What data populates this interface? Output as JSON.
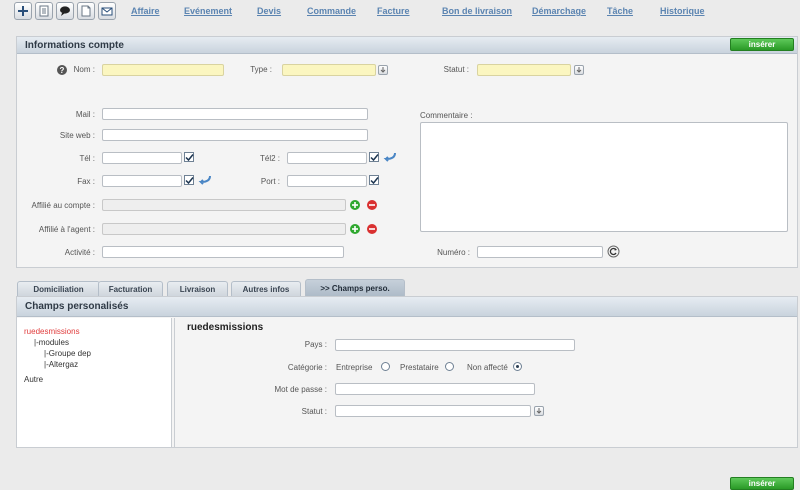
{
  "toolbar": {
    "icons": [
      "add-icon",
      "document-icon",
      "comment-icon",
      "page-icon",
      "mail-icon"
    ],
    "nav": [
      "Affaire",
      "Evénement",
      "Devis",
      "Commande",
      "Facture",
      "Bon de livraison",
      "Démarchage",
      "Tâche",
      "Historique"
    ]
  },
  "account": {
    "title": "Informations compte",
    "insert_label": "insérer",
    "help_glyph": "?",
    "labels": {
      "nom": "Nom :",
      "type": "Type :",
      "statut": "Statut :",
      "mail": "Mail :",
      "site": "Site web :",
      "tel": "Tél :",
      "tel2": "Tél2 :",
      "fax": "Fax :",
      "port": "Port :",
      "affilie_compte": "Affilié au compte :",
      "affilie_agent": "Affilié à l'agent :",
      "activite": "Activité :",
      "commentaire": "Commentaire :",
      "numero": "Numéro :"
    },
    "values": {
      "nom": "",
      "type": "",
      "statut": "",
      "mail": "",
      "site": "",
      "tel": "",
      "tel2": "",
      "fax": "",
      "port": "",
      "affilie_compte": "",
      "affilie_agent": "",
      "activite": "",
      "commentaire": "",
      "numero": ""
    }
  },
  "tabs": [
    "Domiciliation",
    "Facturation",
    "Livraison",
    "Autres infos",
    ">> Champs perso."
  ],
  "custom": {
    "title": "Champs personalisés",
    "tree": {
      "root": "ruedesmissions",
      "modules": "|-modules",
      "groupe": "|-Groupe dep",
      "altergaz": "|-Altergaz",
      "autre": "Autre"
    },
    "section_title": "ruedesmissions",
    "labels": {
      "pays": "Pays :",
      "categorie": "Catégorie :",
      "mot_de_passe": "Mot de passe :",
      "statut": "Statut :"
    },
    "radios": [
      "Entreprise",
      "Prestataire",
      "Non affecté"
    ],
    "selected_radio": "Non affecté"
  },
  "footer": {
    "insert_label": "insérer"
  },
  "colors": {
    "accent_green": "#2a9a27",
    "link_blue": "#5b84b1",
    "tree_root_red": "#e03b3b",
    "required_yellow": "#fbf6c0"
  }
}
